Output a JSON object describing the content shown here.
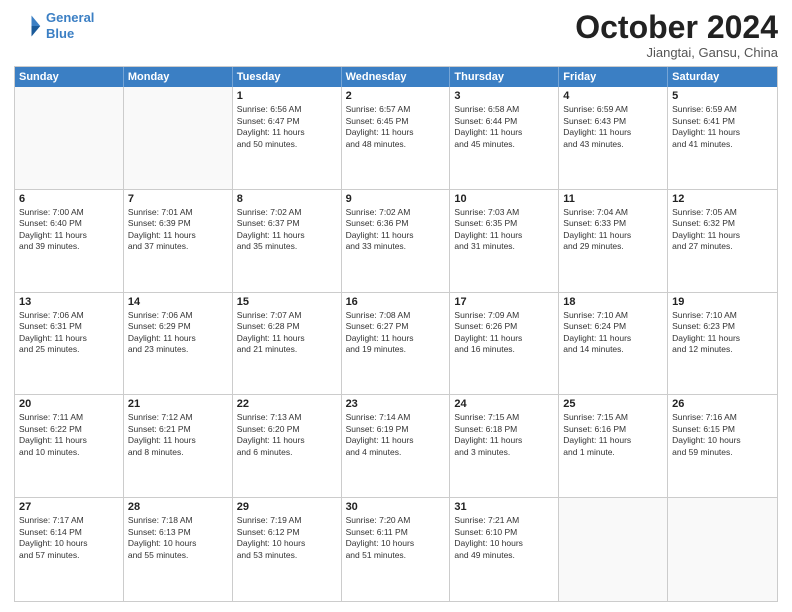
{
  "logo": {
    "line1": "General",
    "line2": "Blue",
    "icon_color": "#3b7fc4"
  },
  "title": "October 2024",
  "location": "Jiangtai, Gansu, China",
  "header_days": [
    "Sunday",
    "Monday",
    "Tuesday",
    "Wednesday",
    "Thursday",
    "Friday",
    "Saturday"
  ],
  "rows": [
    [
      {
        "day": "",
        "empty": true,
        "lines": []
      },
      {
        "day": "",
        "empty": true,
        "lines": []
      },
      {
        "day": "1",
        "empty": false,
        "lines": [
          "Sunrise: 6:56 AM",
          "Sunset: 6:47 PM",
          "Daylight: 11 hours",
          "and 50 minutes."
        ]
      },
      {
        "day": "2",
        "empty": false,
        "lines": [
          "Sunrise: 6:57 AM",
          "Sunset: 6:45 PM",
          "Daylight: 11 hours",
          "and 48 minutes."
        ]
      },
      {
        "day": "3",
        "empty": false,
        "lines": [
          "Sunrise: 6:58 AM",
          "Sunset: 6:44 PM",
          "Daylight: 11 hours",
          "and 45 minutes."
        ]
      },
      {
        "day": "4",
        "empty": false,
        "lines": [
          "Sunrise: 6:59 AM",
          "Sunset: 6:43 PM",
          "Daylight: 11 hours",
          "and 43 minutes."
        ]
      },
      {
        "day": "5",
        "empty": false,
        "lines": [
          "Sunrise: 6:59 AM",
          "Sunset: 6:41 PM",
          "Daylight: 11 hours",
          "and 41 minutes."
        ]
      }
    ],
    [
      {
        "day": "6",
        "empty": false,
        "lines": [
          "Sunrise: 7:00 AM",
          "Sunset: 6:40 PM",
          "Daylight: 11 hours",
          "and 39 minutes."
        ]
      },
      {
        "day": "7",
        "empty": false,
        "lines": [
          "Sunrise: 7:01 AM",
          "Sunset: 6:39 PM",
          "Daylight: 11 hours",
          "and 37 minutes."
        ]
      },
      {
        "day": "8",
        "empty": false,
        "lines": [
          "Sunrise: 7:02 AM",
          "Sunset: 6:37 PM",
          "Daylight: 11 hours",
          "and 35 minutes."
        ]
      },
      {
        "day": "9",
        "empty": false,
        "lines": [
          "Sunrise: 7:02 AM",
          "Sunset: 6:36 PM",
          "Daylight: 11 hours",
          "and 33 minutes."
        ]
      },
      {
        "day": "10",
        "empty": false,
        "lines": [
          "Sunrise: 7:03 AM",
          "Sunset: 6:35 PM",
          "Daylight: 11 hours",
          "and 31 minutes."
        ]
      },
      {
        "day": "11",
        "empty": false,
        "lines": [
          "Sunrise: 7:04 AM",
          "Sunset: 6:33 PM",
          "Daylight: 11 hours",
          "and 29 minutes."
        ]
      },
      {
        "day": "12",
        "empty": false,
        "lines": [
          "Sunrise: 7:05 AM",
          "Sunset: 6:32 PM",
          "Daylight: 11 hours",
          "and 27 minutes."
        ]
      }
    ],
    [
      {
        "day": "13",
        "empty": false,
        "lines": [
          "Sunrise: 7:06 AM",
          "Sunset: 6:31 PM",
          "Daylight: 11 hours",
          "and 25 minutes."
        ]
      },
      {
        "day": "14",
        "empty": false,
        "lines": [
          "Sunrise: 7:06 AM",
          "Sunset: 6:29 PM",
          "Daylight: 11 hours",
          "and 23 minutes."
        ]
      },
      {
        "day": "15",
        "empty": false,
        "lines": [
          "Sunrise: 7:07 AM",
          "Sunset: 6:28 PM",
          "Daylight: 11 hours",
          "and 21 minutes."
        ]
      },
      {
        "day": "16",
        "empty": false,
        "lines": [
          "Sunrise: 7:08 AM",
          "Sunset: 6:27 PM",
          "Daylight: 11 hours",
          "and 19 minutes."
        ]
      },
      {
        "day": "17",
        "empty": false,
        "lines": [
          "Sunrise: 7:09 AM",
          "Sunset: 6:26 PM",
          "Daylight: 11 hours",
          "and 16 minutes."
        ]
      },
      {
        "day": "18",
        "empty": false,
        "lines": [
          "Sunrise: 7:10 AM",
          "Sunset: 6:24 PM",
          "Daylight: 11 hours",
          "and 14 minutes."
        ]
      },
      {
        "day": "19",
        "empty": false,
        "lines": [
          "Sunrise: 7:10 AM",
          "Sunset: 6:23 PM",
          "Daylight: 11 hours",
          "and 12 minutes."
        ]
      }
    ],
    [
      {
        "day": "20",
        "empty": false,
        "lines": [
          "Sunrise: 7:11 AM",
          "Sunset: 6:22 PM",
          "Daylight: 11 hours",
          "and 10 minutes."
        ]
      },
      {
        "day": "21",
        "empty": false,
        "lines": [
          "Sunrise: 7:12 AM",
          "Sunset: 6:21 PM",
          "Daylight: 11 hours",
          "and 8 minutes."
        ]
      },
      {
        "day": "22",
        "empty": false,
        "lines": [
          "Sunrise: 7:13 AM",
          "Sunset: 6:20 PM",
          "Daylight: 11 hours",
          "and 6 minutes."
        ]
      },
      {
        "day": "23",
        "empty": false,
        "lines": [
          "Sunrise: 7:14 AM",
          "Sunset: 6:19 PM",
          "Daylight: 11 hours",
          "and 4 minutes."
        ]
      },
      {
        "day": "24",
        "empty": false,
        "lines": [
          "Sunrise: 7:15 AM",
          "Sunset: 6:18 PM",
          "Daylight: 11 hours",
          "and 3 minutes."
        ]
      },
      {
        "day": "25",
        "empty": false,
        "lines": [
          "Sunrise: 7:15 AM",
          "Sunset: 6:16 PM",
          "Daylight: 11 hours",
          "and 1 minute."
        ]
      },
      {
        "day": "26",
        "empty": false,
        "lines": [
          "Sunrise: 7:16 AM",
          "Sunset: 6:15 PM",
          "Daylight: 10 hours",
          "and 59 minutes."
        ]
      }
    ],
    [
      {
        "day": "27",
        "empty": false,
        "lines": [
          "Sunrise: 7:17 AM",
          "Sunset: 6:14 PM",
          "Daylight: 10 hours",
          "and 57 minutes."
        ]
      },
      {
        "day": "28",
        "empty": false,
        "lines": [
          "Sunrise: 7:18 AM",
          "Sunset: 6:13 PM",
          "Daylight: 10 hours",
          "and 55 minutes."
        ]
      },
      {
        "day": "29",
        "empty": false,
        "lines": [
          "Sunrise: 7:19 AM",
          "Sunset: 6:12 PM",
          "Daylight: 10 hours",
          "and 53 minutes."
        ]
      },
      {
        "day": "30",
        "empty": false,
        "lines": [
          "Sunrise: 7:20 AM",
          "Sunset: 6:11 PM",
          "Daylight: 10 hours",
          "and 51 minutes."
        ]
      },
      {
        "day": "31",
        "empty": false,
        "lines": [
          "Sunrise: 7:21 AM",
          "Sunset: 6:10 PM",
          "Daylight: 10 hours",
          "and 49 minutes."
        ]
      },
      {
        "day": "",
        "empty": true,
        "lines": []
      },
      {
        "day": "",
        "empty": true,
        "lines": []
      }
    ]
  ]
}
